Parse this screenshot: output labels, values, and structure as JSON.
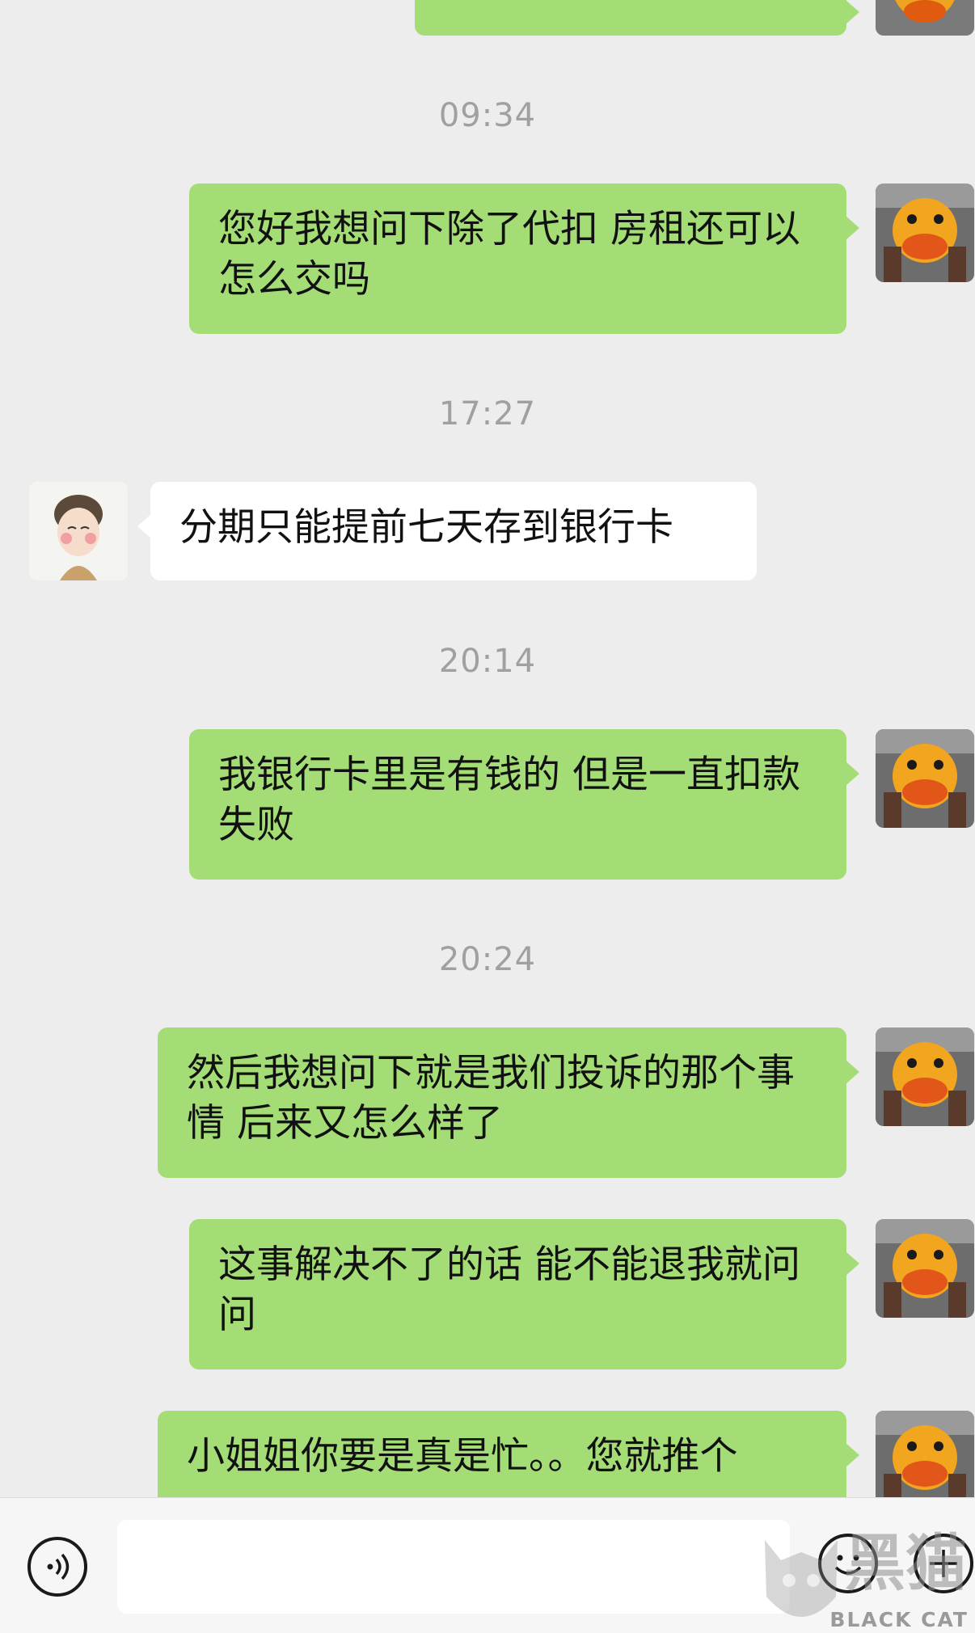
{
  "messages": [
    {
      "type": "time",
      "text": "09:34"
    },
    {
      "type": "outgoing",
      "text": "您好我想问下除了代扣 房租还可以怎么交吗"
    },
    {
      "type": "time",
      "text": "17:27"
    },
    {
      "type": "incoming",
      "text": "分期只能提前七天存到银行卡"
    },
    {
      "type": "time",
      "text": "20:14"
    },
    {
      "type": "outgoing",
      "text": "我银行卡里是有钱的 但是一直扣款失败"
    },
    {
      "type": "time",
      "text": "20:24"
    },
    {
      "type": "outgoing",
      "text": "然后我想问下就是我们投诉的那个事情 后来又怎么样了"
    },
    {
      "type": "outgoing",
      "text": "这事解决不了的话 能不能退我就问问"
    },
    {
      "type": "outgoing",
      "text": "小姐姐你要是真是忙。。您就推个"
    }
  ],
  "input": {
    "value": "",
    "placeholder": ""
  },
  "watermark": {
    "cn": "黑猫",
    "en": "BLACK CAT"
  },
  "icons": {
    "voice": "voice-icon",
    "emoji": "emoji-icon",
    "add": "plus-icon"
  },
  "colors": {
    "outgoing_bubble": "#a4dd76",
    "incoming_bubble": "#ffffff",
    "background": "#ededed",
    "timestamp": "#a0a0a0"
  }
}
